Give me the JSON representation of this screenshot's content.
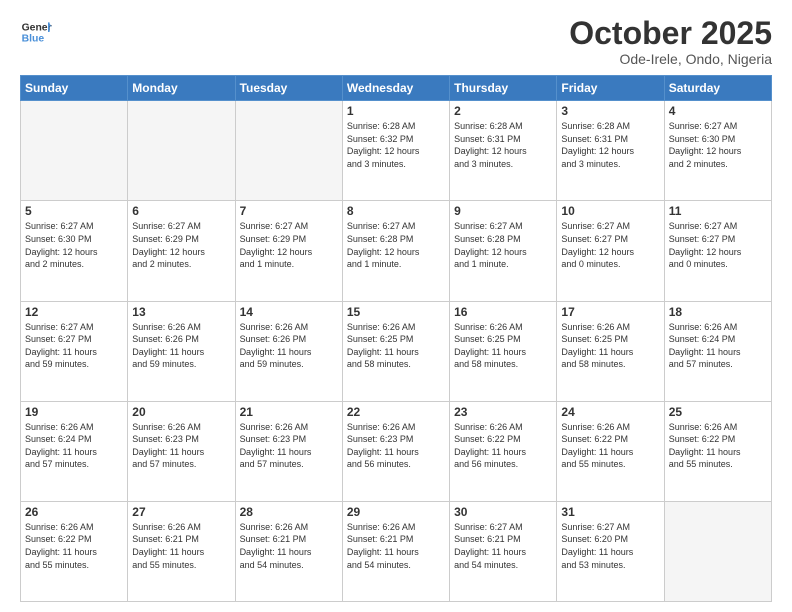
{
  "header": {
    "logo_general": "General",
    "logo_blue": "Blue",
    "month_title": "October 2025",
    "location": "Ode-Irele, Ondo, Nigeria"
  },
  "weekdays": [
    "Sunday",
    "Monday",
    "Tuesday",
    "Wednesday",
    "Thursday",
    "Friday",
    "Saturday"
  ],
  "weeks": [
    [
      {
        "day": "",
        "info": ""
      },
      {
        "day": "",
        "info": ""
      },
      {
        "day": "",
        "info": ""
      },
      {
        "day": "1",
        "info": "Sunrise: 6:28 AM\nSunset: 6:32 PM\nDaylight: 12 hours\nand 3 minutes."
      },
      {
        "day": "2",
        "info": "Sunrise: 6:28 AM\nSunset: 6:31 PM\nDaylight: 12 hours\nand 3 minutes."
      },
      {
        "day": "3",
        "info": "Sunrise: 6:28 AM\nSunset: 6:31 PM\nDaylight: 12 hours\nand 3 minutes."
      },
      {
        "day": "4",
        "info": "Sunrise: 6:27 AM\nSunset: 6:30 PM\nDaylight: 12 hours\nand 2 minutes."
      }
    ],
    [
      {
        "day": "5",
        "info": "Sunrise: 6:27 AM\nSunset: 6:30 PM\nDaylight: 12 hours\nand 2 minutes."
      },
      {
        "day": "6",
        "info": "Sunrise: 6:27 AM\nSunset: 6:29 PM\nDaylight: 12 hours\nand 2 minutes."
      },
      {
        "day": "7",
        "info": "Sunrise: 6:27 AM\nSunset: 6:29 PM\nDaylight: 12 hours\nand 1 minute."
      },
      {
        "day": "8",
        "info": "Sunrise: 6:27 AM\nSunset: 6:28 PM\nDaylight: 12 hours\nand 1 minute."
      },
      {
        "day": "9",
        "info": "Sunrise: 6:27 AM\nSunset: 6:28 PM\nDaylight: 12 hours\nand 1 minute."
      },
      {
        "day": "10",
        "info": "Sunrise: 6:27 AM\nSunset: 6:27 PM\nDaylight: 12 hours\nand 0 minutes."
      },
      {
        "day": "11",
        "info": "Sunrise: 6:27 AM\nSunset: 6:27 PM\nDaylight: 12 hours\nand 0 minutes."
      }
    ],
    [
      {
        "day": "12",
        "info": "Sunrise: 6:27 AM\nSunset: 6:27 PM\nDaylight: 11 hours\nand 59 minutes."
      },
      {
        "day": "13",
        "info": "Sunrise: 6:26 AM\nSunset: 6:26 PM\nDaylight: 11 hours\nand 59 minutes."
      },
      {
        "day": "14",
        "info": "Sunrise: 6:26 AM\nSunset: 6:26 PM\nDaylight: 11 hours\nand 59 minutes."
      },
      {
        "day": "15",
        "info": "Sunrise: 6:26 AM\nSunset: 6:25 PM\nDaylight: 11 hours\nand 58 minutes."
      },
      {
        "day": "16",
        "info": "Sunrise: 6:26 AM\nSunset: 6:25 PM\nDaylight: 11 hours\nand 58 minutes."
      },
      {
        "day": "17",
        "info": "Sunrise: 6:26 AM\nSunset: 6:25 PM\nDaylight: 11 hours\nand 58 minutes."
      },
      {
        "day": "18",
        "info": "Sunrise: 6:26 AM\nSunset: 6:24 PM\nDaylight: 11 hours\nand 57 minutes."
      }
    ],
    [
      {
        "day": "19",
        "info": "Sunrise: 6:26 AM\nSunset: 6:24 PM\nDaylight: 11 hours\nand 57 minutes."
      },
      {
        "day": "20",
        "info": "Sunrise: 6:26 AM\nSunset: 6:23 PM\nDaylight: 11 hours\nand 57 minutes."
      },
      {
        "day": "21",
        "info": "Sunrise: 6:26 AM\nSunset: 6:23 PM\nDaylight: 11 hours\nand 57 minutes."
      },
      {
        "day": "22",
        "info": "Sunrise: 6:26 AM\nSunset: 6:23 PM\nDaylight: 11 hours\nand 56 minutes."
      },
      {
        "day": "23",
        "info": "Sunrise: 6:26 AM\nSunset: 6:22 PM\nDaylight: 11 hours\nand 56 minutes."
      },
      {
        "day": "24",
        "info": "Sunrise: 6:26 AM\nSunset: 6:22 PM\nDaylight: 11 hours\nand 55 minutes."
      },
      {
        "day": "25",
        "info": "Sunrise: 6:26 AM\nSunset: 6:22 PM\nDaylight: 11 hours\nand 55 minutes."
      }
    ],
    [
      {
        "day": "26",
        "info": "Sunrise: 6:26 AM\nSunset: 6:22 PM\nDaylight: 11 hours\nand 55 minutes."
      },
      {
        "day": "27",
        "info": "Sunrise: 6:26 AM\nSunset: 6:21 PM\nDaylight: 11 hours\nand 55 minutes."
      },
      {
        "day": "28",
        "info": "Sunrise: 6:26 AM\nSunset: 6:21 PM\nDaylight: 11 hours\nand 54 minutes."
      },
      {
        "day": "29",
        "info": "Sunrise: 6:26 AM\nSunset: 6:21 PM\nDaylight: 11 hours\nand 54 minutes."
      },
      {
        "day": "30",
        "info": "Sunrise: 6:27 AM\nSunset: 6:21 PM\nDaylight: 11 hours\nand 54 minutes."
      },
      {
        "day": "31",
        "info": "Sunrise: 6:27 AM\nSunset: 6:20 PM\nDaylight: 11 hours\nand 53 minutes."
      },
      {
        "day": "",
        "info": ""
      }
    ]
  ]
}
